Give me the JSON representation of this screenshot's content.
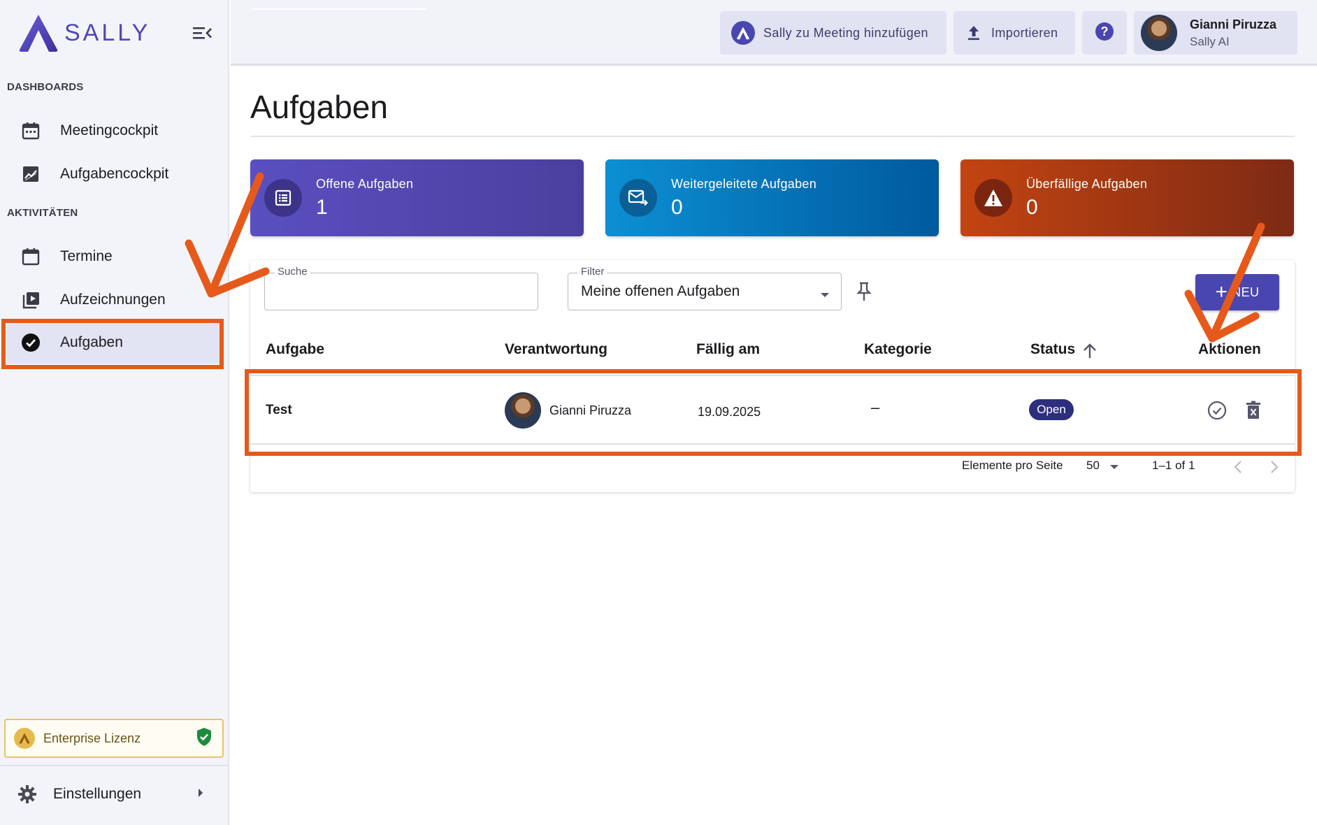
{
  "app": {
    "logo_text": "SALLY"
  },
  "sidebar": {
    "sections": [
      {
        "label": "DASHBOARDS"
      },
      {
        "label": "AKTIVITÄTEN"
      }
    ],
    "items": [
      {
        "label": "Meetingcockpit",
        "icon": "calendar-icon"
      },
      {
        "label": "Aufgabencockpit",
        "icon": "chart-icon"
      },
      {
        "label": "Termine",
        "icon": "calendar-blank-icon"
      },
      {
        "label": "Aufzeichnungen",
        "icon": "video-library-icon"
      },
      {
        "label": "Aufgaben",
        "icon": "check-circle-icon",
        "active": true
      }
    ],
    "license_label": "Enterprise Lizenz",
    "settings_label": "Einstellungen"
  },
  "topbar": {
    "add_meeting_label": "Sally zu Meeting hinzufügen",
    "import_label": "Importieren",
    "help_icon": "help-icon",
    "user_name": "Gianni Piruzza",
    "user_org": "Sally AI"
  },
  "page": {
    "title": "Aufgaben"
  },
  "stats": [
    {
      "label": "Offene Aufgaben",
      "value": "1",
      "color_start": "#5a4fc0",
      "color_end": "#4b3f9e"
    },
    {
      "label": "Weitergeleitete Aufgaben",
      "value": "0",
      "color_start": "#0c8fd3",
      "color_end": "#005a9e"
    },
    {
      "label": "Überfällige Aufgaben",
      "value": "0",
      "color_start": "#c34411",
      "color_end": "#7e2a14"
    }
  ],
  "filters": {
    "search_label": "Suche",
    "search_value": "",
    "filter_label": "Filter",
    "filter_value": "Meine offenen Aufgaben",
    "new_label": "NEU"
  },
  "table": {
    "columns": [
      "Aufgabe",
      "Verantwortung",
      "Fällig am",
      "Kategorie",
      "Status",
      "Aktionen"
    ],
    "rows": [
      {
        "task": "Test",
        "owner": "Gianni Piruzza",
        "due": "19.09.2025",
        "category": "–",
        "status": "Open"
      }
    ]
  },
  "pagination": {
    "per_page_label": "Elemente pro Seite",
    "per_page_value": "50",
    "range": "1–1 of 1"
  },
  "colors": {
    "accent": "#4a46b0",
    "highlight": "#e55a1b"
  }
}
